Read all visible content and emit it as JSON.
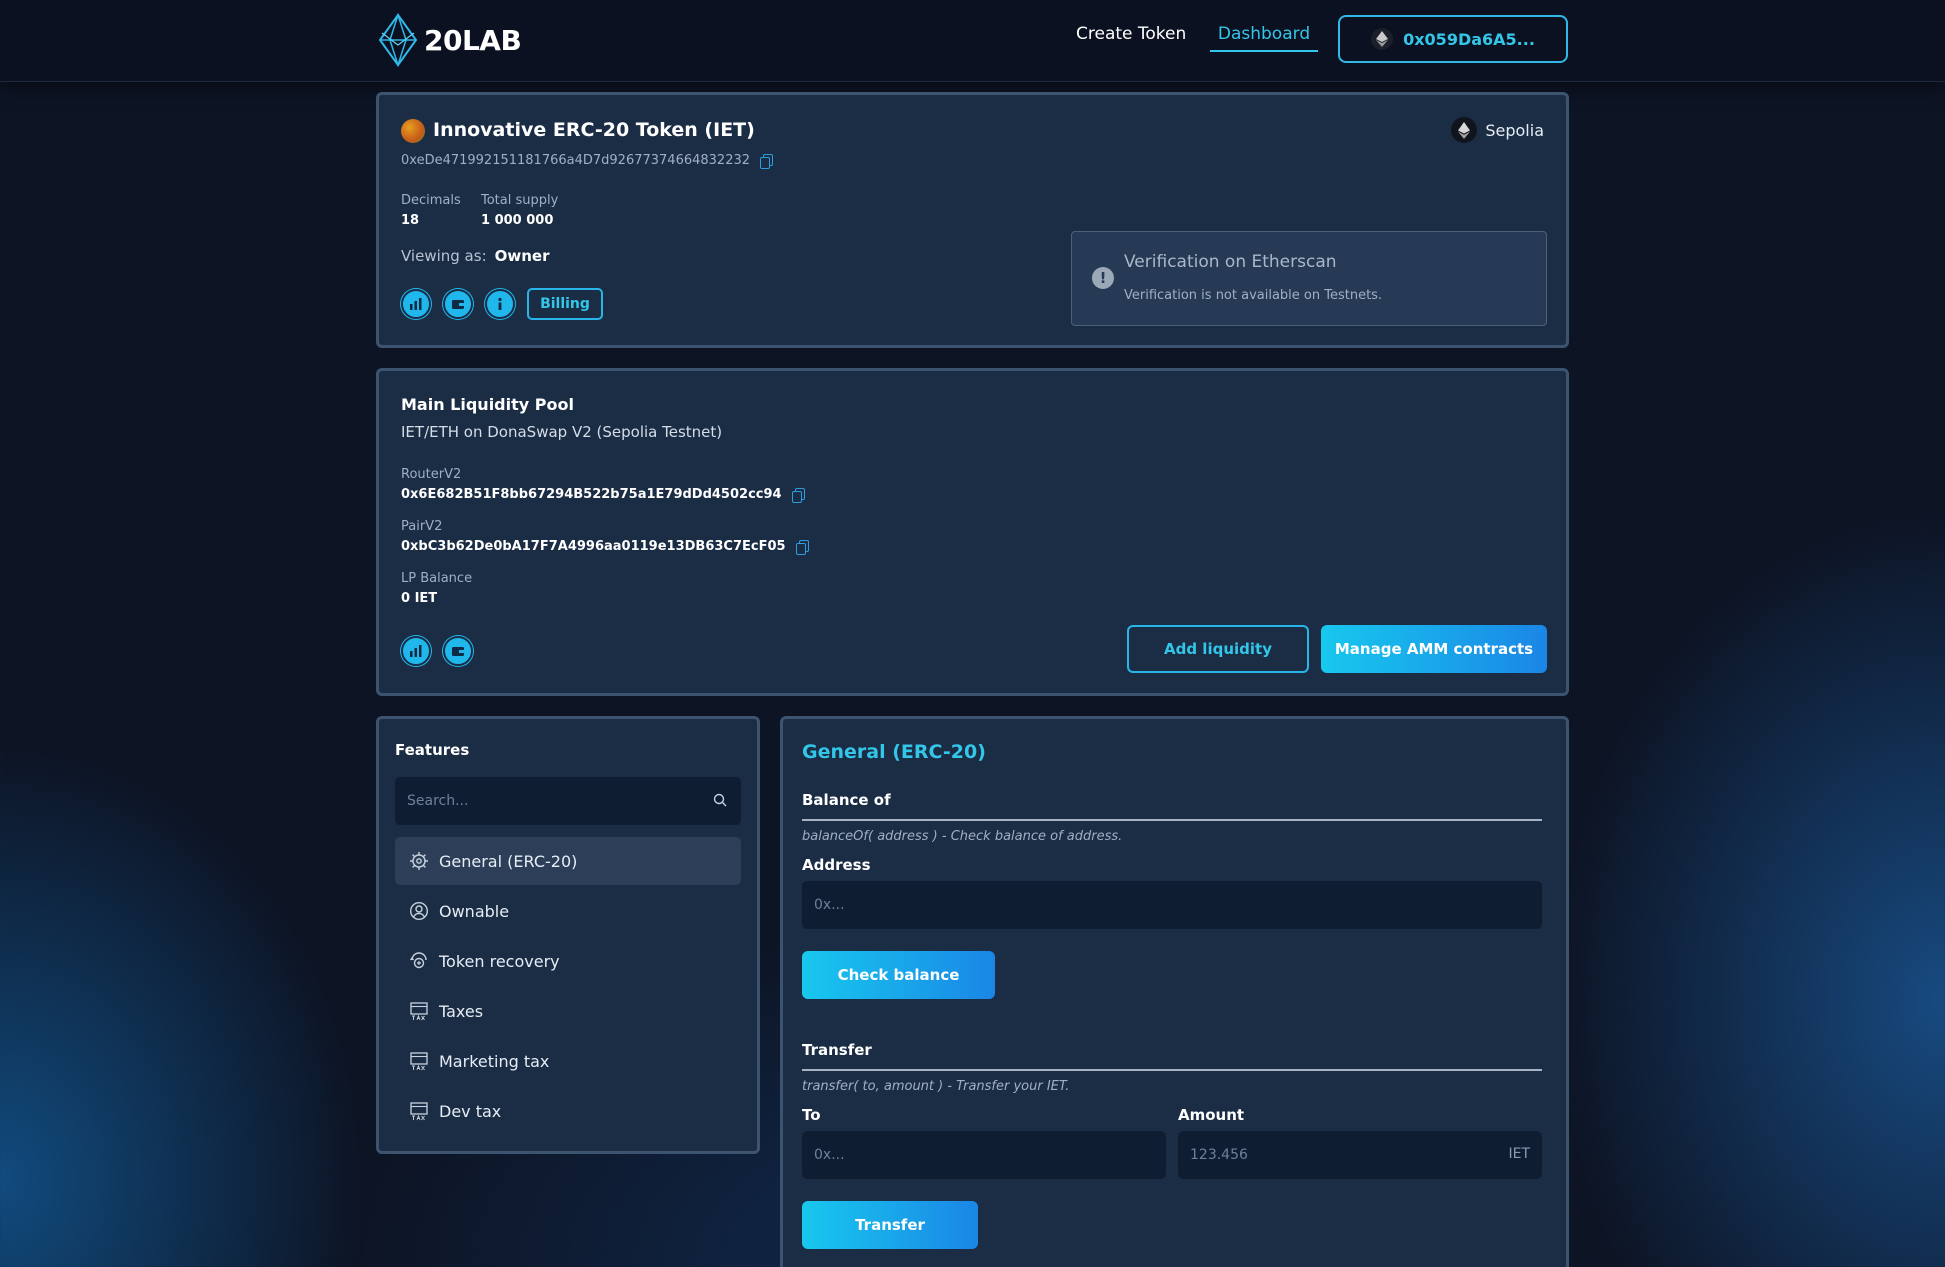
{
  "header": {
    "logo_text": "20LAB",
    "nav": {
      "create_token": "Create Token",
      "dashboard": "Dashboard"
    },
    "wallet": "0x059Da6A5..."
  },
  "token": {
    "name": "Innovative ERC-20 Token (IET)",
    "address": "0xeDe471992151181766a4D7d92677374664832232",
    "network": "Sepolia",
    "decimals_label": "Decimals",
    "decimals": "18",
    "supply_label": "Total supply",
    "supply": "1 000 000",
    "viewing_label": "Viewing as:",
    "viewing_role": "Owner",
    "billing": "Billing",
    "verification": {
      "title": "Verification on Etherscan",
      "message": "Verification is not available on Testnets.",
      "icon": "!"
    }
  },
  "pool": {
    "title": "Main Liquidity Pool",
    "subtitle": "IET/ETH on DonaSwap V2 (Sepolia Testnet)",
    "router_label": "RouterV2",
    "router": "0x6E682B51F8bb67294B522b75a1E79dDd4502cc94",
    "pair_label": "PairV2",
    "pair": "0xbC3b62De0bA17F7A4996aa0119e13DB63C7EcF05",
    "lp_label": "LP Balance",
    "lp_balance": "0 IET",
    "add_liquidity": "Add liquidity",
    "manage": "Manage AMM contracts"
  },
  "features": {
    "title": "Features",
    "search_placeholder": "Search...",
    "items": [
      {
        "label": "General (ERC-20)",
        "icon": "gear-chip-icon"
      },
      {
        "label": "Ownable",
        "icon": "user-circle-icon"
      },
      {
        "label": "Token recovery",
        "icon": "recovery-icon"
      },
      {
        "label": "Taxes",
        "icon": "tax-icon"
      },
      {
        "label": "Marketing tax",
        "icon": "tax-icon"
      },
      {
        "label": "Dev tax",
        "icon": "tax-icon"
      }
    ]
  },
  "general": {
    "title": "General (ERC-20)",
    "balance": {
      "title": "Balance of",
      "desc": "balanceOf( address ) - Check balance of address.",
      "address_label": "Address",
      "address_placeholder": "0x...",
      "button": "Check balance"
    },
    "transfer": {
      "title": "Transfer",
      "desc": "transfer( to, amount ) - Transfer your IET.",
      "to_label": "To",
      "to_placeholder": "0x...",
      "amount_label": "Amount",
      "amount_placeholder": "123.456",
      "unit": "IET",
      "button": "Transfer"
    }
  },
  "colors": {
    "accent": "#33c6e8",
    "card_bg": "#1b2c45",
    "page_bg": "#0d1424"
  }
}
